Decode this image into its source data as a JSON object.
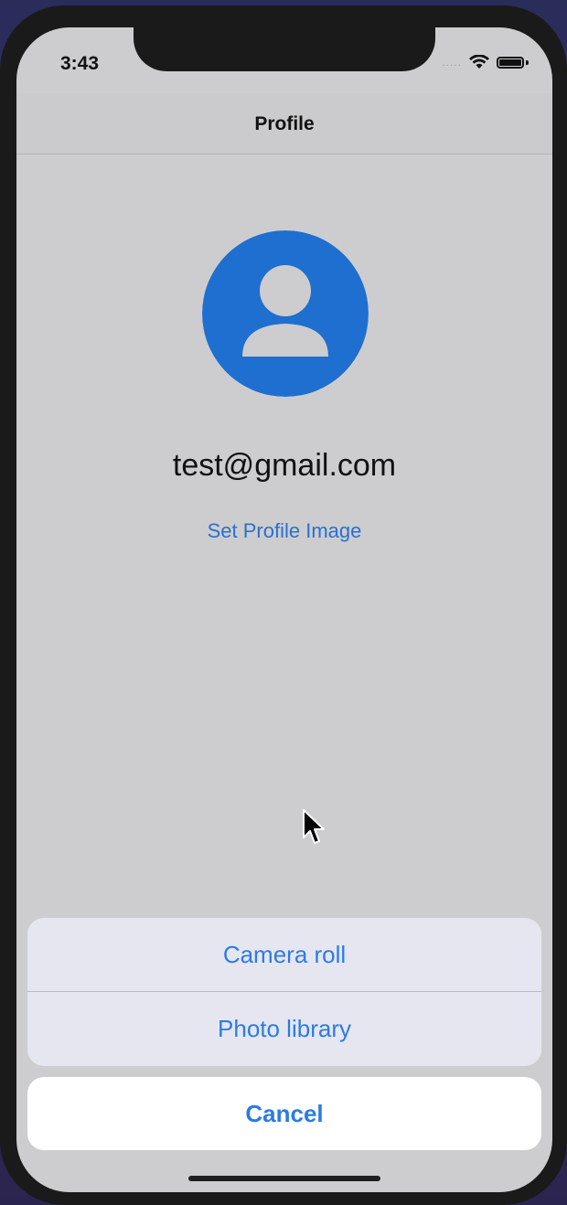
{
  "status_bar": {
    "time": "3:43",
    "signal": "....."
  },
  "nav": {
    "title": "Profile"
  },
  "profile": {
    "avatar_icon": "person-circle-icon",
    "avatar_color": "#1f6fd0",
    "email": "test@gmail.com",
    "set_image_label": "Set Profile Image"
  },
  "action_sheet": {
    "options": [
      {
        "label": "Camera roll"
      },
      {
        "label": "Photo library"
      }
    ],
    "cancel_label": "Cancel"
  },
  "colors": {
    "accent": "#2c7be5",
    "screen_bg": "#cdcdcf"
  }
}
